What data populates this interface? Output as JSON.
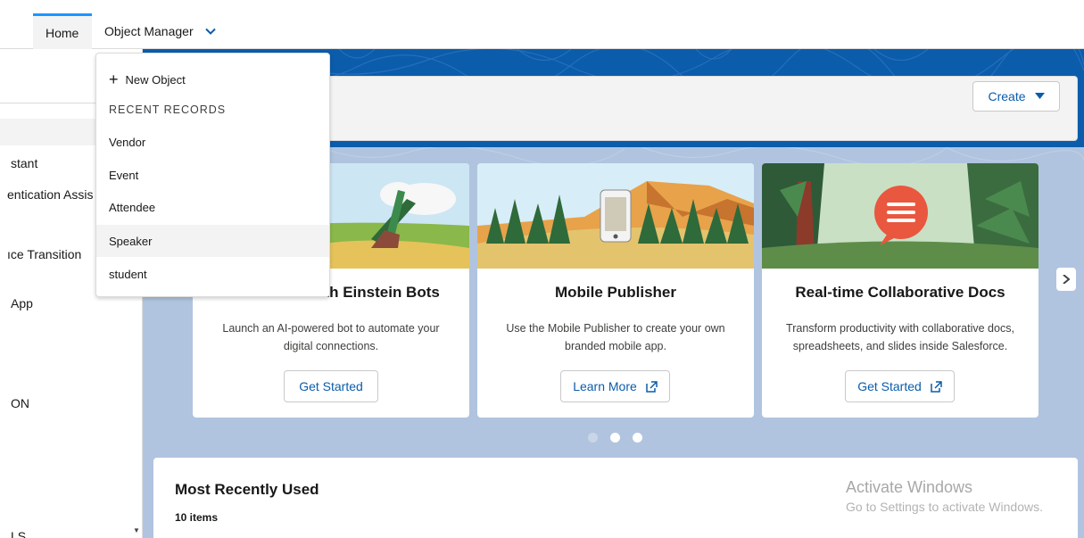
{
  "nav": {
    "tabs": [
      {
        "label": "Home"
      },
      {
        "label": "Object Manager"
      }
    ]
  },
  "sidebar": {
    "items": [
      {
        "label": "stant"
      },
      {
        "label": "entication Assis"
      },
      {
        "label": "ıce Transition"
      },
      {
        "label": "App"
      },
      {
        "label": "ON"
      },
      {
        "label": "LS"
      }
    ]
  },
  "dropdown": {
    "new_object": "New Object",
    "header": "RECENT RECORDS",
    "items": [
      {
        "label": "Vendor"
      },
      {
        "label": "Event"
      },
      {
        "label": "Attendee"
      },
      {
        "label": "Speaker"
      },
      {
        "label": "student"
      }
    ]
  },
  "header": {
    "create_label": "Create"
  },
  "cards": [
    {
      "title": "Get Started with Einstein Bots",
      "desc": "Launch an AI-powered bot to automate your digital connections.",
      "button": "Get Started"
    },
    {
      "title": "Mobile Publisher",
      "desc": "Use the Mobile Publisher to create your own branded mobile app.",
      "button": "Learn More"
    },
    {
      "title": "Real-time Collaborative Docs",
      "desc": "Transform productivity with collaborative docs, spreadsheets, and slides inside Salesforce.",
      "button": "Get Started"
    }
  ],
  "carousel": {
    "active_index": 1,
    "count": 3
  },
  "recent": {
    "title": "Most Recently Used",
    "count": "10 items"
  },
  "watermark": {
    "line1": "Activate Windows",
    "line2": "Go to Settings to activate Windows."
  },
  "colors": {
    "accent": "#0b5cab",
    "tab_indicator": "#1b96ff",
    "main_bg": "#b0c4df",
    "chat_bubble": "#e9573f"
  }
}
